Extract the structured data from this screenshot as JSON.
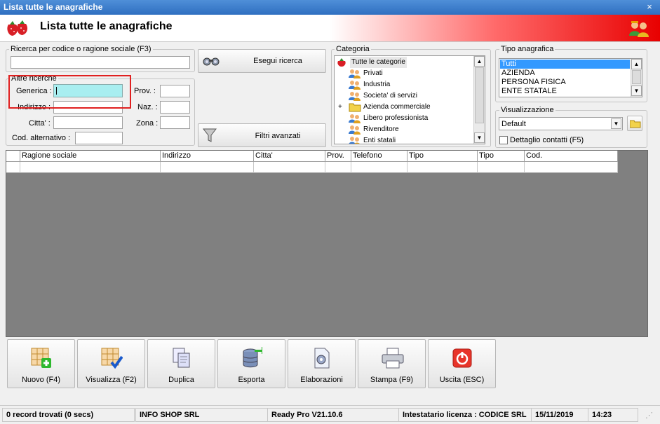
{
  "window": {
    "title": "Lista tutte le anagrafiche",
    "close": "×"
  },
  "header": {
    "title": "Lista tutte le anagrafiche"
  },
  "search": {
    "legend": "Ricerca per codice o ragione sociale (F3)",
    "value": "",
    "execute_label": "Esegui ricerca",
    "advanced_label": "Filtri avanzati"
  },
  "other": {
    "legend": "Altre ricerche",
    "generica_label": "Generica :",
    "indirizzo_label": "Indirizzo :",
    "citta_label": "Citta' :",
    "cod_alt_label": "Cod. alternativo :",
    "prov_label": "Prov. :",
    "naz_label": "Naz. :",
    "zona_label": "Zona :",
    "highlight_color": "#e02020"
  },
  "category": {
    "legend": "Categoria",
    "items": [
      {
        "label": "Tutte le categorie",
        "icon": "strawberry-icon",
        "expander": ""
      },
      {
        "label": "Privati",
        "icon": "people-icon",
        "expander": ""
      },
      {
        "label": "Industria",
        "icon": "people-icon",
        "expander": ""
      },
      {
        "label": "Societa' di servizi",
        "icon": "people-icon",
        "expander": ""
      },
      {
        "label": "Azienda commerciale",
        "icon": "folder-icon",
        "expander": "+"
      },
      {
        "label": "Libero professionista",
        "icon": "people-icon",
        "expander": ""
      },
      {
        "label": "Rivenditore",
        "icon": "people-icon",
        "expander": ""
      },
      {
        "label": "Enti statali",
        "icon": "people-icon",
        "expander": ""
      }
    ]
  },
  "tipo": {
    "legend": "Tipo anagrafica",
    "items": [
      "Tutti",
      "AZIENDA",
      "PERSONA FISICA",
      "ENTE STATALE"
    ],
    "selected_index": 0,
    "selection_color": "#3399ff"
  },
  "visual": {
    "legend": "Visualizzazione",
    "selected": "Default",
    "details_label": "Dettaglio contatti (F5)"
  },
  "grid": {
    "columns": [
      "",
      "Ragione sociale",
      "Indirizzo",
      "Citta'",
      "Prov.",
      "Telefono",
      "Tipo",
      "Tipo",
      "Cod."
    ],
    "background": "#808080"
  },
  "toolbar": {
    "buttons": [
      {
        "label": "Nuovo (F4)",
        "icon": "grid-add-icon"
      },
      {
        "label": "Visualizza (F2)",
        "icon": "grid-check-icon"
      },
      {
        "label": "Duplica",
        "icon": "duplicate-icon"
      },
      {
        "label": "Esporta",
        "icon": "database-export-icon"
      },
      {
        "label": "Elaborazioni",
        "icon": "gear-document-icon"
      },
      {
        "label": "Stampa (F9)",
        "icon": "printer-icon"
      },
      {
        "label": "Uscita (ESC)",
        "icon": "power-icon"
      }
    ]
  },
  "status": {
    "records": "0 record trovati (0 secs)",
    "company": "INFO SHOP SRL",
    "version": "Ready Pro V21.10.6",
    "license": "Intestatario licenza : CODICE SRL",
    "date": "15/11/2019",
    "time": "14:23"
  }
}
